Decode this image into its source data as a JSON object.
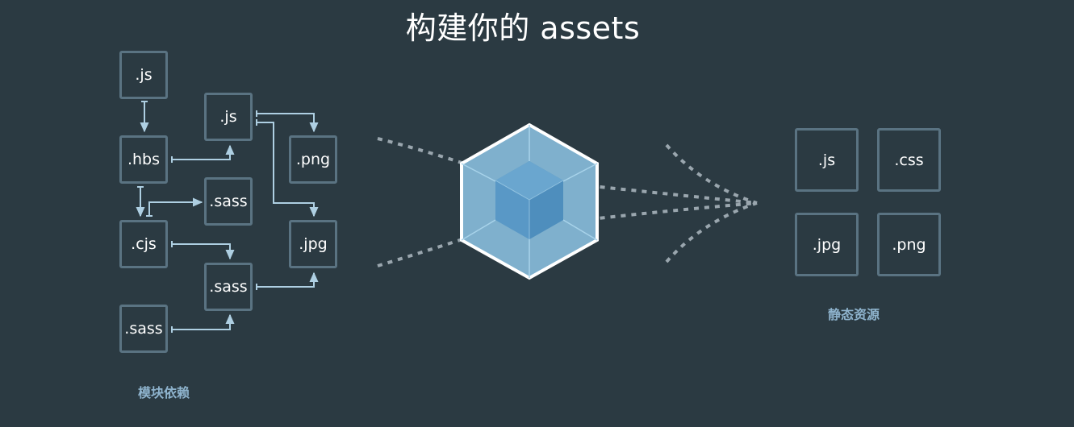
{
  "title": "构建你的 assets",
  "modules": {
    "caption": "模块依赖",
    "items": [
      ".js",
      ".js",
      ".hbs",
      ".png",
      ".sass",
      ".cjs",
      ".jpg",
      ".sass",
      ".sass"
    ]
  },
  "assets": {
    "caption": "静态资源",
    "items": [
      ".js",
      ".css",
      ".jpg",
      ".png"
    ]
  },
  "colors": {
    "background": "#2b3a42",
    "box_border": "#5a7382",
    "arrow": "#aecfe2",
    "cube_outer": "#8ed6fb",
    "cube_inner": "#1c78c0",
    "dotted": "#9aa6ae",
    "caption": "#8eb3cd"
  }
}
